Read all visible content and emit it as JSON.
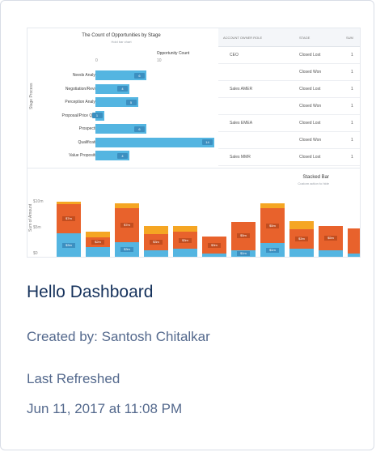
{
  "dashboard": {
    "title": "Hello Dashboard",
    "created_by": "Created by: Santosh Chitalkar",
    "refreshed_label": "Last Refreshed",
    "refreshed_value": "Jun 11, 2017 at 11:08 PM"
  },
  "thumbnail": {
    "bar_chart": {
      "title": "The Count of Opportunities by Stage",
      "subtitle": "Hold bar chart",
      "x_title": "Opportunity Count",
      "y_title": "Stage Process",
      "ticks": [
        "0",
        "10"
      ],
      "rows": [
        {
          "label": "Needs Analysis",
          "value": 6,
          "badge": "6"
        },
        {
          "label": "Negotiation/Review",
          "value": 4,
          "badge": "4"
        },
        {
          "label": "Perception Analysis",
          "value": 5,
          "badge": "5"
        },
        {
          "label": "Proposal/Price Quote",
          "value": 1,
          "badge": "1"
        },
        {
          "label": "Prospecting",
          "value": 6,
          "badge": "6"
        },
        {
          "label": "Qualification",
          "value": 14,
          "badge": "14"
        },
        {
          "label": "Value Proposition",
          "value": 4,
          "badge": "4"
        }
      ]
    },
    "table": {
      "headers": [
        "ACCOUNT OWNER ROLE",
        "STAGE",
        "SUM"
      ],
      "rows": [
        {
          "role": "CEO",
          "stage": "Closed Lost",
          "sum": "1"
        },
        {
          "role": "",
          "stage": "Closed Won",
          "sum": "1"
        },
        {
          "role": "Sales AMER",
          "stage": "Closed Lost",
          "sum": "1"
        },
        {
          "role": "",
          "stage": "Closed Won",
          "sum": "1"
        },
        {
          "role": "Sales EMEA",
          "stage": "Closed Lost",
          "sum": "1"
        },
        {
          "role": "",
          "stage": "Closed Won",
          "sum": "1"
        },
        {
          "role": "Sales MMR",
          "stage": "Closed Lost",
          "sum": "1"
        }
      ]
    },
    "stacked_chart": {
      "title": "Stacked Bar",
      "subtitle": "Custom action to hide",
      "y_title": "Sum of Amount",
      "ticks": [
        "$10m",
        "$5m",
        "$0"
      ],
      "colors": {
        "blue": "#54b5e1",
        "orange": "#e8622c",
        "yellow": "#f5a623"
      },
      "bars": [
        {
          "blue": 2.4,
          "orange": 3.0,
          "yellow": 0.3,
          "blue_label": "$3m",
          "orange_label": "$7m"
        },
        {
          "blue": 1.0,
          "orange": 1.0,
          "yellow": 0.6,
          "blue_label": "",
          "orange_label": "$2m"
        },
        {
          "blue": 1.5,
          "orange": 3.5,
          "yellow": 0.5,
          "blue_label": "$3m",
          "orange_label": "$7m"
        },
        {
          "blue": 0.7,
          "orange": 1.6,
          "yellow": 0.9,
          "blue_label": "",
          "orange_label": "$3m"
        },
        {
          "blue": 0.8,
          "orange": 1.8,
          "yellow": 0.6,
          "blue_label": "",
          "orange_label": "$3m"
        },
        {
          "blue": 0.3,
          "orange": 1.8,
          "yellow": 0.0,
          "blue_label": "",
          "orange_label": "$3m"
        },
        {
          "blue": 0.7,
          "orange": 2.9,
          "yellow": 0.0,
          "blue_label": "$1m",
          "orange_label": "$5m"
        },
        {
          "blue": 1.4,
          "orange": 3.6,
          "yellow": 0.5,
          "blue_label": "$1m",
          "orange_label": "$5m"
        },
        {
          "blue": 0.8,
          "orange": 2.0,
          "yellow": 0.9,
          "blue_label": "",
          "orange_label": "$3m"
        },
        {
          "blue": 0.7,
          "orange": 2.5,
          "yellow": 0.0,
          "blue_label": "",
          "orange_label": "$5m"
        },
        {
          "blue": 0.3,
          "orange": 2.6,
          "yellow": 0.0,
          "blue_label": "",
          "orange_label": ""
        }
      ]
    }
  }
}
